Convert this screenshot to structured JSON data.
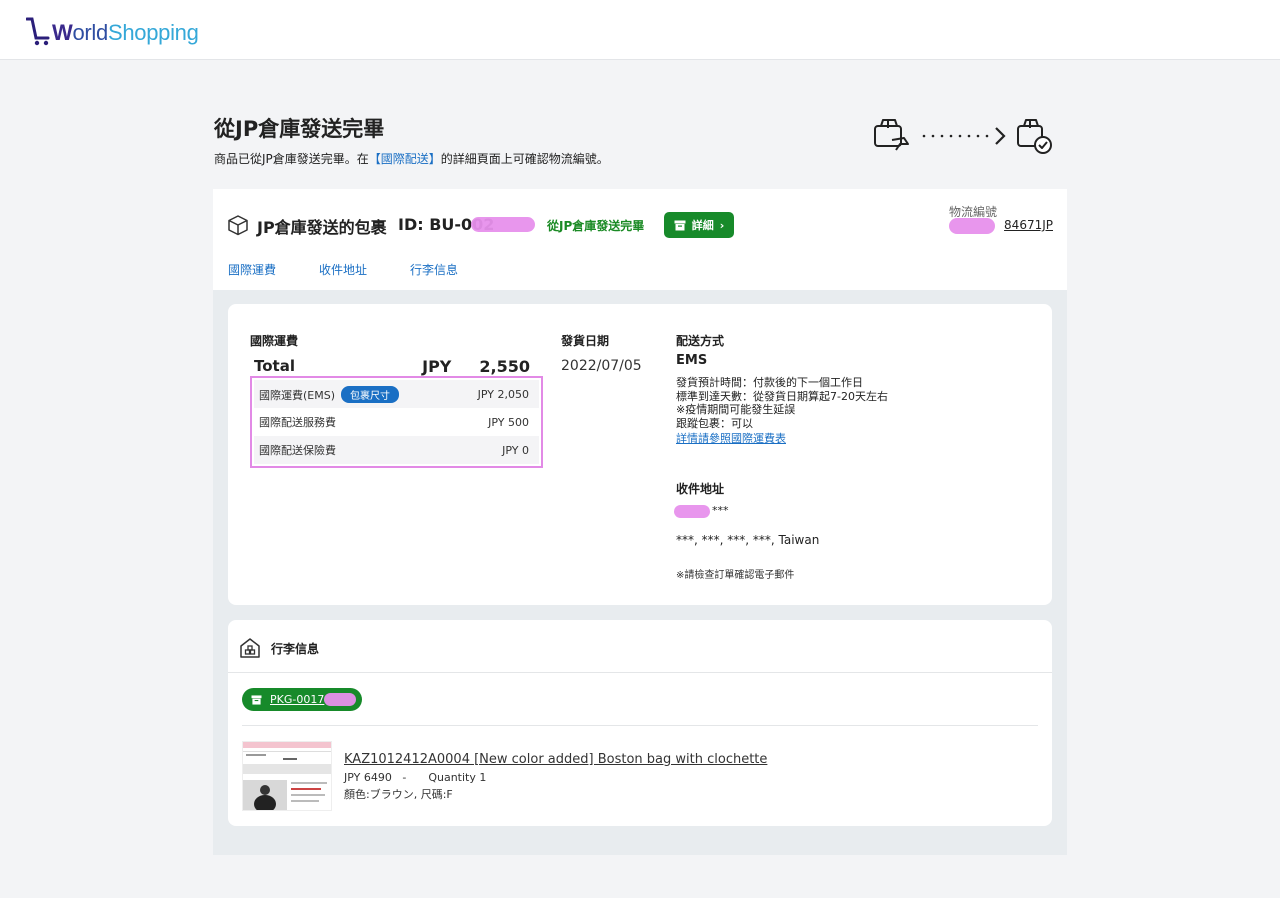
{
  "brand": {
    "logo_word_1": "W",
    "logo_word_2": "orld",
    "logo_word_3": "Shopping"
  },
  "page": {
    "title": "從JP倉庫發送完畢",
    "subtitle_prefix": "商品已從JP倉庫發送完畢。在",
    "subtitle_link": "【國際配送】",
    "subtitle_suffix": "的詳細頁面上可確認物流編號。"
  },
  "package": {
    "title": "JP倉庫發送的包裹",
    "id": "ID: BU-002",
    "status": "從JP倉庫發送完畢",
    "detail_button": "詳細",
    "tracking_label": "物流編號",
    "tracking_number": "84671JP"
  },
  "tabs": [
    {
      "label": "國際運費"
    },
    {
      "label": "收件地址"
    },
    {
      "label": "行李信息"
    }
  ],
  "shipping_fee": {
    "label": "國際運費",
    "total_label": "Total",
    "currency": "JPY",
    "total": "2,550",
    "rows": [
      {
        "label": "國際運費(EMS)",
        "badge": "包裹尺寸",
        "amount": "JPY 2,050"
      },
      {
        "label": "國際配送服務費",
        "amount": "JPY 500"
      },
      {
        "label": "國際配送保險費",
        "amount": "JPY 0"
      }
    ]
  },
  "ship_date": {
    "label": "發貨日期",
    "value": "2022/07/05"
  },
  "delivery": {
    "label": "配送方式",
    "method": "EMS",
    "lines": [
      "發貨預計時間：付款後的下一個工作日",
      "標準到達天數：從發貨日期算起7-20天左右",
      "※疫情期間可能發生延誤",
      "跟蹤包裹：可以"
    ],
    "link": "詳情請參照國際運費表"
  },
  "address": {
    "label": "收件地址",
    "name": "***",
    "line": "***, ***, ***, ***, Taiwan",
    "note": "※請檢查訂單確認電子郵件"
  },
  "luggage": {
    "title": "行李信息",
    "package_code": "PKG-0017",
    "item": {
      "title": "KAZ1012412A0004 [New color added] Boston bag with clochette",
      "price": "JPY 6490",
      "separator": "-",
      "quantity": "Quantity 1",
      "options": "顏色:ブラウン, 尺碼:F"
    }
  },
  "colors": {
    "accent_blue": "#1a6fc4",
    "status_green": "#178a2a",
    "highlight_pink": "#e28ae6"
  }
}
